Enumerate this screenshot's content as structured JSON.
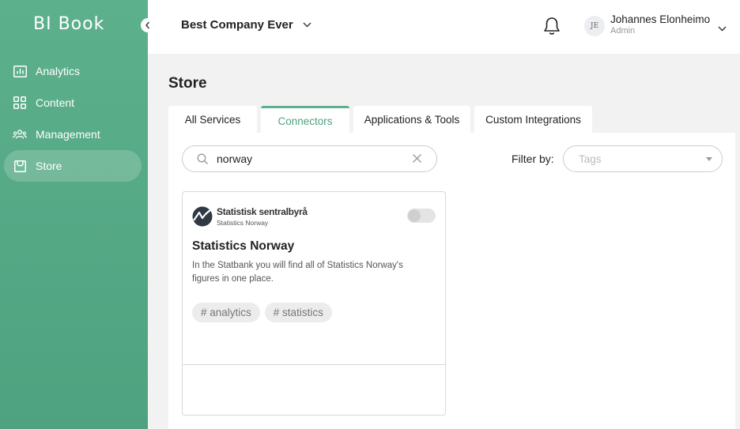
{
  "app": {
    "logo_text": "BI Book"
  },
  "sidebar": {
    "items": [
      {
        "label": "Analytics",
        "icon": "chart-icon"
      },
      {
        "label": "Content",
        "icon": "grid-icon"
      },
      {
        "label": "Management",
        "icon": "users-icon"
      },
      {
        "label": "Store",
        "icon": "store-icon",
        "active": true
      }
    ]
  },
  "header": {
    "company": "Best Company Ever",
    "user": {
      "initials": "JE",
      "name": "Johannes Elonheimo",
      "role": "Admin"
    }
  },
  "main": {
    "title": "Store",
    "tabs": [
      {
        "label": "All Services"
      },
      {
        "label": "Connectors",
        "active": true
      },
      {
        "label": "Applications & Tools"
      },
      {
        "label": "Custom Integrations"
      }
    ],
    "search": {
      "value": "norway",
      "placeholder": ""
    },
    "filter": {
      "label": "Filter by:",
      "placeholder": "Tags"
    }
  },
  "cards": [
    {
      "brand_name": "Statistisk sentralbyrå",
      "brand_sub": "Statistics Norway",
      "title": "Statistics Norway",
      "description": "In the Statbank you will find all of Statistics Norway's figures in one place.",
      "tags": [
        "# analytics",
        "# statistics"
      ],
      "enabled": false
    }
  ],
  "colors": {
    "accent": "#5db08c",
    "sidebar": "#4fa27f",
    "background": "#f2f2f2"
  }
}
